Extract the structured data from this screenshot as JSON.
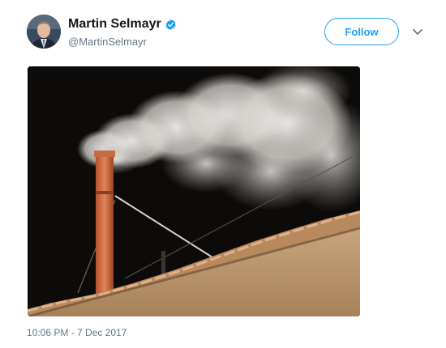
{
  "tweet": {
    "author": {
      "name": "Martin Selmayr",
      "handle": "@MartinSelmayr",
      "verified": true,
      "avatar_icon": "profile-photo"
    },
    "follow_label": "Follow",
    "menu_icon": "chevron-down-icon",
    "image_icon": "smoke-from-chimney-photo",
    "timestamp": "10:06 PM - 7 Dec 2017"
  },
  "colors": {
    "accent": "#1da1f2",
    "secondary_text": "#657786",
    "primary_text": "#14171a"
  }
}
